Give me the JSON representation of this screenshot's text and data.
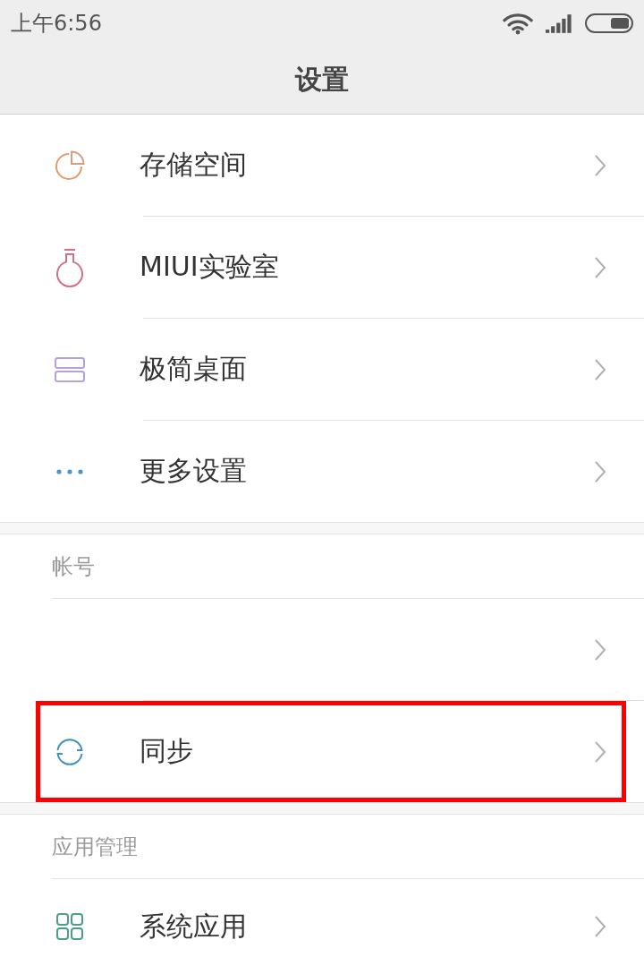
{
  "status_bar": {
    "time": "上午6:56"
  },
  "title": "设置",
  "sections": [
    {
      "rows": [
        {
          "kind": "storage",
          "label": "存储空间",
          "highlighted": false
        },
        {
          "kind": "lab",
          "label": "MIUI实验室",
          "highlighted": false
        },
        {
          "kind": "desktop",
          "label": "极简桌面",
          "highlighted": false
        },
        {
          "kind": "more",
          "label": "更多设置",
          "highlighted": false
        }
      ]
    },
    {
      "header": "帐号",
      "rows": [
        {
          "kind": "account",
          "highlighted": false
        },
        {
          "kind": "sync",
          "label": "同步",
          "highlighted": true
        }
      ]
    },
    {
      "header": "应用管理",
      "rows": [
        {
          "kind": "apps",
          "label": "系统应用",
          "highlighted": false
        }
      ]
    }
  ]
}
